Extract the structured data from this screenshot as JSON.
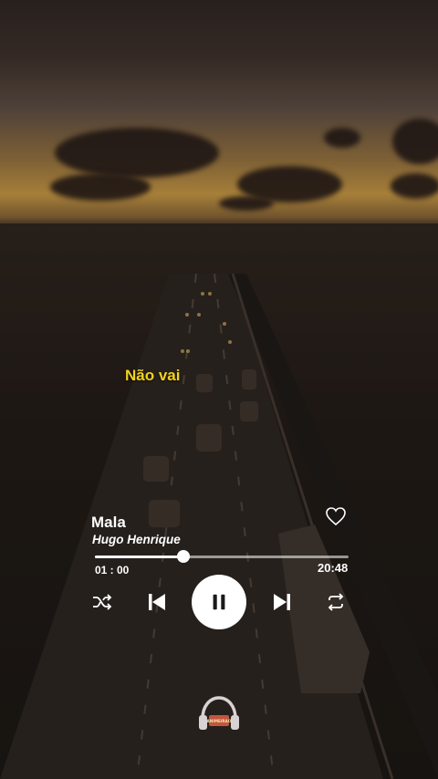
{
  "lyric": "Não vai",
  "player": {
    "title": "Mala",
    "artist": "Hugo Henrique",
    "current_time": "01 : 00",
    "total_time": "20:48",
    "progress": 0.35,
    "state": "playing"
  },
  "controls": {
    "shuffle_icon": "shuffle-icon",
    "prev_icon": "skip-previous-icon",
    "play_pause_icon": "pause-icon",
    "next_icon": "skip-next-icon",
    "repeat_icon": "repeat-icon",
    "favorite_icon": "heart-icon"
  },
  "colors": {
    "lyric": "#f1d21c",
    "text": "#ffffff"
  },
  "logo": {
    "name": "headphones-logo",
    "text": "ANIMEIRAO"
  }
}
